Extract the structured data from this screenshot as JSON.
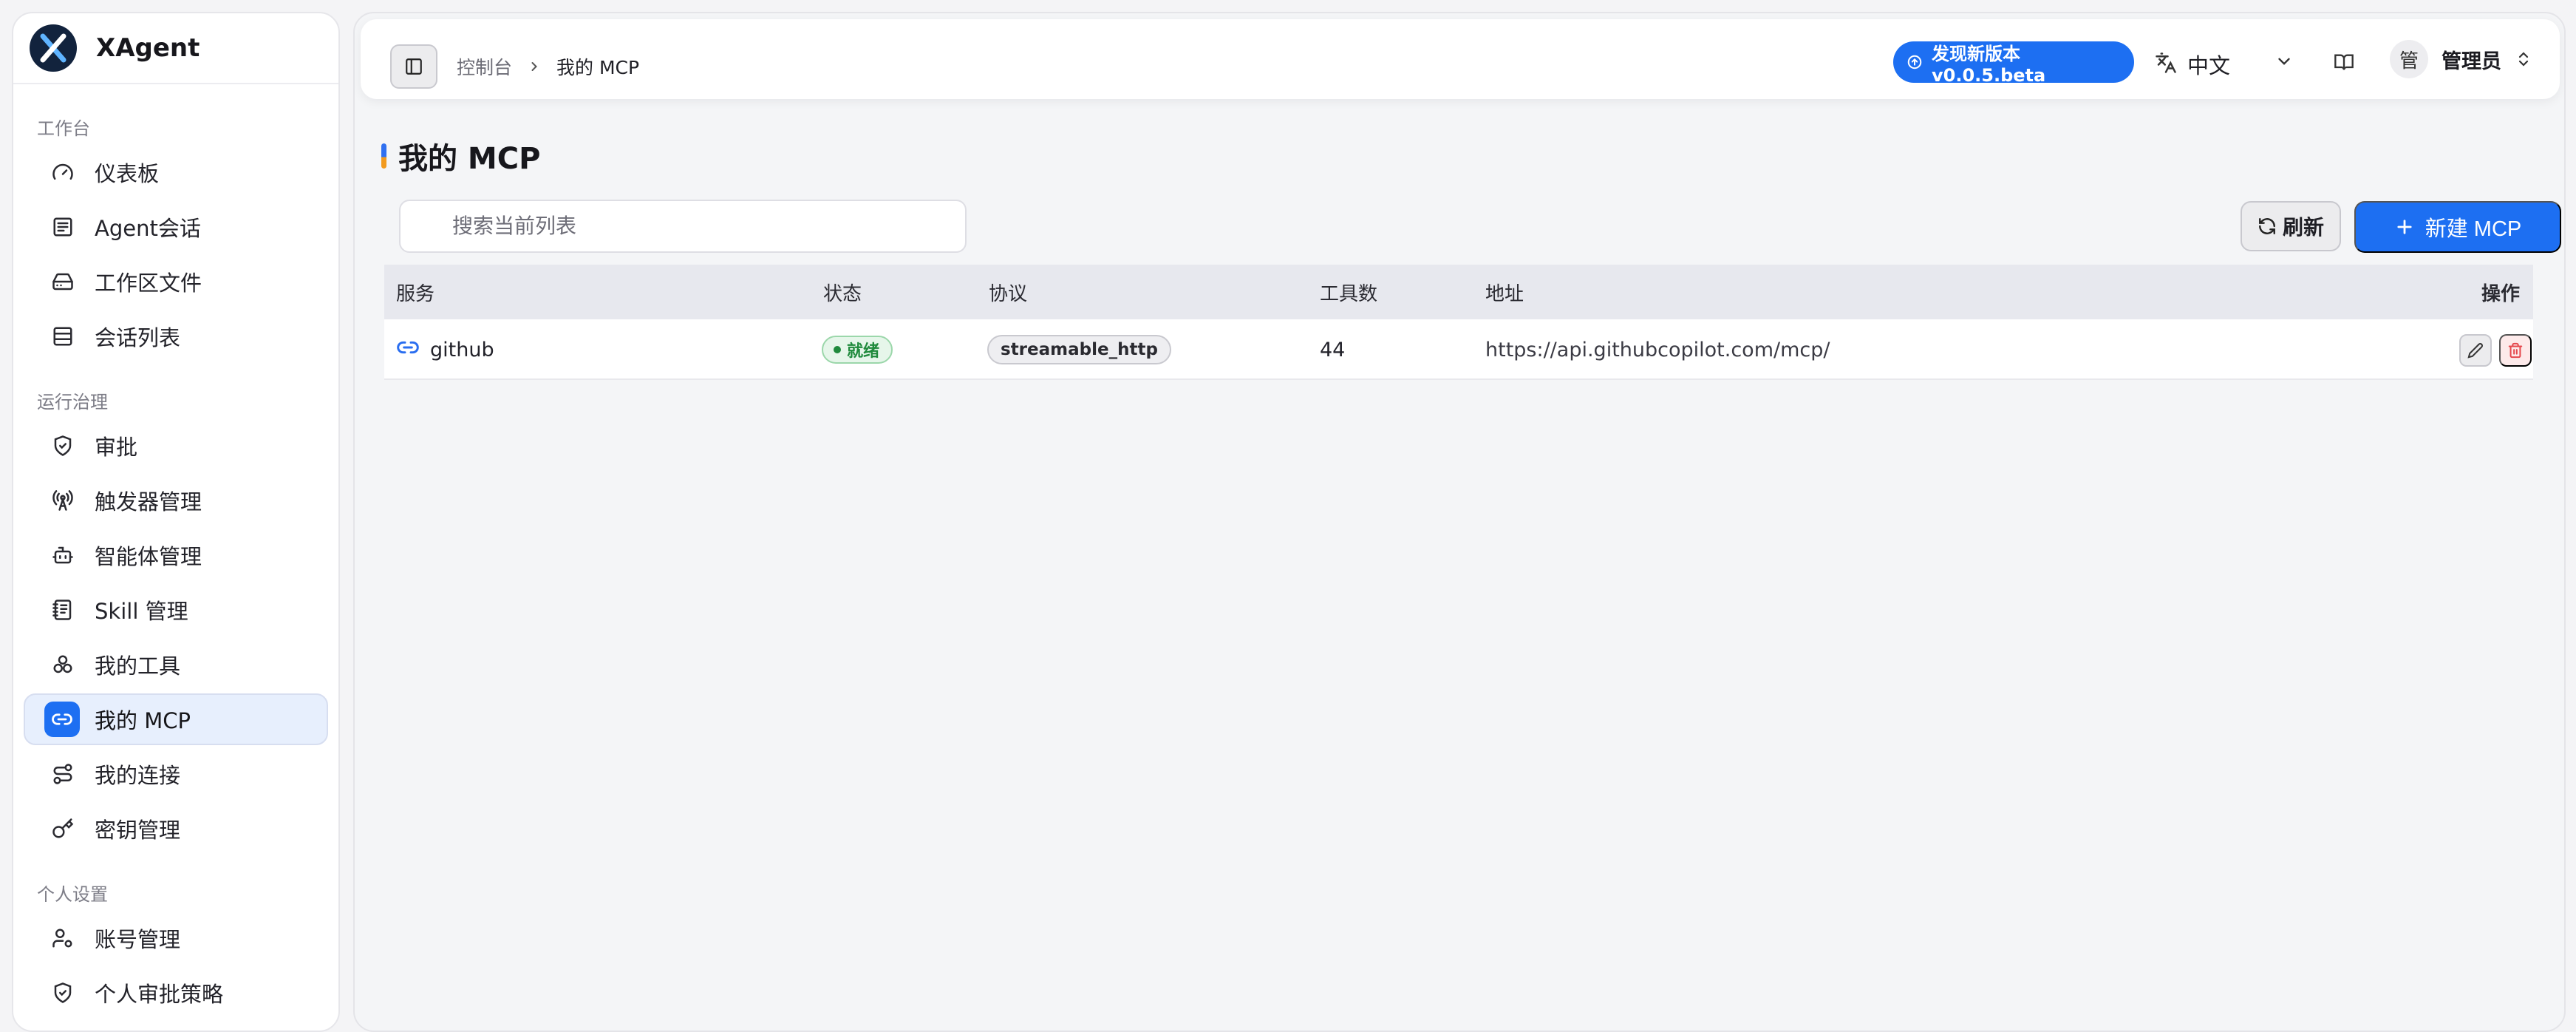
{
  "app": {
    "name": "XAgent"
  },
  "sidebar": {
    "sections": [
      {
        "label": "工作台",
        "items": [
          {
            "label": "仪表板",
            "icon": "gauge-icon"
          },
          {
            "label": "Agent会话",
            "icon": "chat-list-icon"
          },
          {
            "label": "工作区文件",
            "icon": "inbox-drive-icon"
          },
          {
            "label": "会话列表",
            "icon": "table-list-icon"
          }
        ]
      },
      {
        "label": "运行治理",
        "items": [
          {
            "label": "审批",
            "icon": "shield-check-icon"
          },
          {
            "label": "触发器管理",
            "icon": "radio-tower-icon"
          },
          {
            "label": "智能体管理",
            "icon": "robot-icon"
          },
          {
            "label": "Skill 管理",
            "icon": "notebook-icon"
          },
          {
            "label": "我的工具",
            "icon": "boxes-icon"
          },
          {
            "label": "我的 MCP",
            "icon": "link-icon",
            "active": true
          },
          {
            "label": "我的连接",
            "icon": "route-icon"
          },
          {
            "label": "密钥管理",
            "icon": "key-icon"
          }
        ]
      },
      {
        "label": "个人设置",
        "items": [
          {
            "label": "账号管理",
            "icon": "user-cog-icon"
          },
          {
            "label": "个人审批策略",
            "icon": "shield-check-icon"
          }
        ]
      }
    ]
  },
  "header": {
    "breadcrumb": {
      "root": "控制台",
      "current": "我的 MCP"
    },
    "version_badge": "发现新版本 v0.0.5.beta",
    "language": "中文",
    "user": {
      "avatar": "管",
      "name": "管理员"
    }
  },
  "page": {
    "title": "我的 MCP",
    "search_placeholder": "搜索当前列表",
    "refresh_label": "刷新",
    "new_label": "新建 MCP"
  },
  "table": {
    "headers": {
      "service": "服务",
      "status": "状态",
      "protocol": "协议",
      "tools": "工具数",
      "address": "地址",
      "actions": "操作"
    },
    "rows": [
      {
        "service": "github",
        "status": "就绪",
        "protocol": "streamable_http",
        "tools": "44",
        "address": "https://api.githubcopilot.com/mcp/"
      }
    ]
  },
  "colors": {
    "accent": "#1d6ff2",
    "success": "#1f8a3c",
    "danger": "#e5484d"
  }
}
